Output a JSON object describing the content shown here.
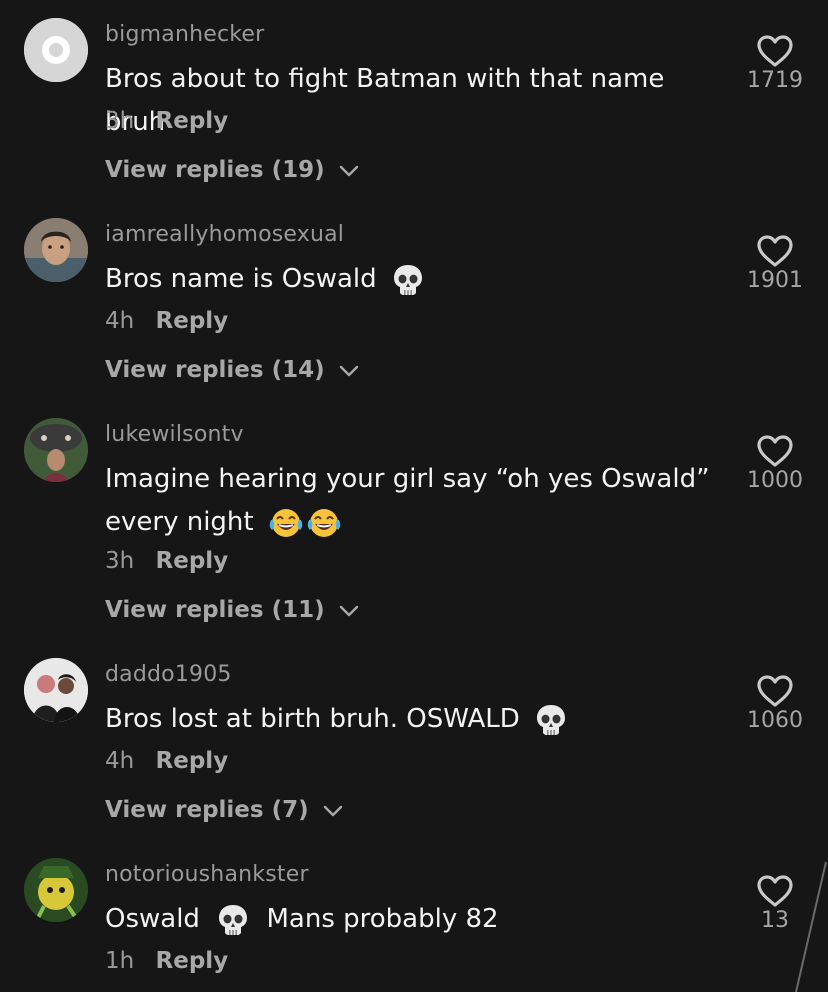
{
  "comments": [
    {
      "username": "bigmanhecker",
      "text": "Bros about to fight Batman with that name bruh",
      "time": "3h",
      "reply_label": "Reply",
      "view_replies": "View replies (19)",
      "likes": "1719",
      "avatar_icon": "default-avatar-icon"
    },
    {
      "username": "iamreallyhomosexual",
      "text": "Bros name is Oswald",
      "emoji": [
        "skull-emoji"
      ],
      "time": "4h",
      "reply_label": "Reply",
      "view_replies": "View replies (14)",
      "likes": "1901"
    },
    {
      "username": "lukewilsontv",
      "text": "Imagine hearing your girl say “oh yes Oswald” every night",
      "emoji": [
        "laughing-crying-emoji",
        "laughing-crying-emoji"
      ],
      "time": "3h",
      "reply_label": "Reply",
      "view_replies": "View replies (11)",
      "likes": "1000"
    },
    {
      "username": "daddo1905",
      "text": "Bros lost at birth bruh. OSWALD",
      "emoji": [
        "skull-emoji"
      ],
      "time": "4h",
      "reply_label": "Reply",
      "view_replies": "View replies (7)",
      "likes": "1060"
    },
    {
      "username": "notorioushankster",
      "text_before": "Oswald",
      "text_after": "Mans probably 82",
      "emoji": [
        "skull-emoji"
      ],
      "time": "1h",
      "reply_label": "Reply",
      "likes": "13"
    }
  ],
  "colors": {
    "background": "#161616",
    "text": "#f3f3f3",
    "muted": "#9a9a9a"
  }
}
